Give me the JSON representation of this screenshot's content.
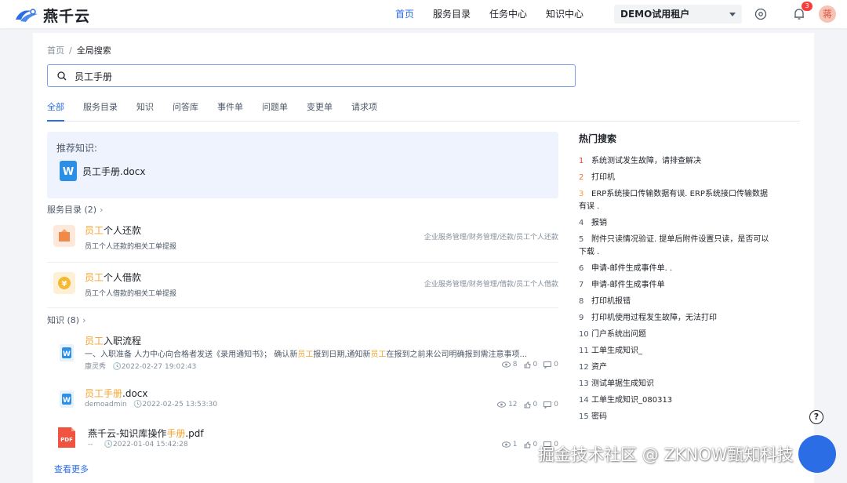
{
  "app": {
    "name": "燕千云"
  },
  "nav": [
    "首页",
    "服务目录",
    "任务中心",
    "知识中心"
  ],
  "tenant": "DEMO试用租户",
  "notifications": {
    "count": "3"
  },
  "user": {
    "avatar_text": "蒋"
  },
  "breadcrumb": {
    "home": "首页",
    "sep": "/",
    "current": "全局搜索"
  },
  "search": {
    "value": "员工手册"
  },
  "tabs": [
    "全部",
    "服务目录",
    "知识",
    "问答库",
    "事件单",
    "问题单",
    "变更单",
    "请求项"
  ],
  "recommend": {
    "title": "推荐知识:",
    "doc_name": "员工手册.docx"
  },
  "services": {
    "title": "服务目录 (2)",
    "items": [
      {
        "name_hl": "员工",
        "name_rest": "个人还款",
        "desc": "员工个人还款的相关工单提报",
        "path": "企业服务管理/财务管理/还款/员工个人还款"
      },
      {
        "name_hl": "员工",
        "name_rest": "个人借款",
        "desc": "员工个人借款的相关工单提报",
        "path": "企业服务管理/财务管理/借款/员工个人借款"
      }
    ]
  },
  "knowledge": {
    "title": "知识 (8)",
    "items": [
      {
        "title_hl": "员工",
        "title_rest": "入职流程",
        "snippet_a": "一、入职准备 人力中心向合格者发送《录用通知书》； 确认新",
        "snippet_hl1": "员工",
        "snippet_b": "报到日期,通知新",
        "snippet_hl2": "员工",
        "snippet_c": "在报到之前来公司明确报到需注意事项...",
        "author": "康灵秀",
        "time": "2022-02-27 19:02:43",
        "views": "8",
        "likes": "0",
        "comments": "0"
      },
      {
        "title_hl": "员工手册",
        "title_rest": ".docx",
        "author": "demoadmin",
        "time": "2022-02-25 13:53:30",
        "views": "12",
        "likes": "0",
        "comments": "0"
      },
      {
        "title_a": "燕千云-知识库操作",
        "title_hl": "手册",
        "title_rest": ".pdf",
        "author": "--",
        "time": "2022-01-04 15:42:28",
        "views": "1",
        "likes": "0",
        "comments": "0"
      }
    ],
    "more": "查看更多"
  },
  "hot_search": {
    "title": "热门搜索",
    "items": [
      {
        "n": "1",
        "text": "系统测试发生故障，请排查解决"
      },
      {
        "n": "2",
        "text": "打印机"
      },
      {
        "n": "3",
        "text": "ERP系统接口传输数据有误. ERP系统接口传输数据有误 ."
      },
      {
        "n": "4",
        "text": "报销"
      },
      {
        "n": "5",
        "text": "附件只读情况验证. 提单后附件设置只读，是否可以下载 ."
      },
      {
        "n": "6",
        "text": "申请-邮件生成事件单. ."
      },
      {
        "n": "7",
        "text": "申请-邮件生成事件单"
      },
      {
        "n": "8",
        "text": "打印机报错"
      },
      {
        "n": "9",
        "text": "打印机使用过程发生故障，无法打印"
      },
      {
        "n": "10",
        "text": "门户系统出问题"
      },
      {
        "n": "11",
        "text": "工单生成知识_"
      },
      {
        "n": "12",
        "text": "资产"
      },
      {
        "n": "13",
        "text": "测试单据生成知识"
      },
      {
        "n": "14",
        "text": "工单生成知识_080313"
      },
      {
        "n": "15",
        "text": "密码"
      }
    ]
  },
  "help": "?",
  "watermark": "掘金技术社区 @ ZKNOW甄知科技",
  "colors": {
    "primary": "#2b6de5",
    "highlight": "#f7a32d",
    "rank1": "#f53f3f",
    "rank2": "#f77234",
    "rank3": "#f7a32d"
  }
}
